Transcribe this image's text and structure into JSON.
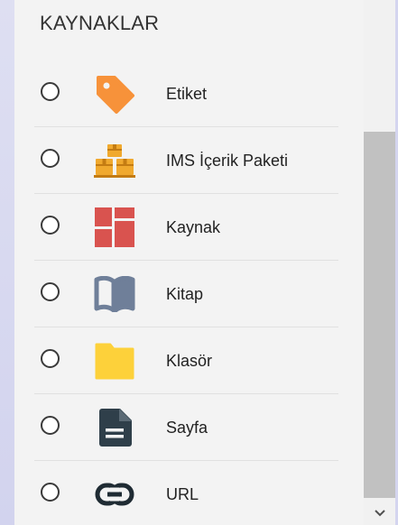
{
  "section": {
    "title": "KAYNAKLAR"
  },
  "items": [
    {
      "label": "Etiket",
      "icon": "label-tag-icon",
      "color": "#f7923a"
    },
    {
      "label": "IMS İçerik Paketi",
      "icon": "ims-package-icon",
      "color": "#f0a92e"
    },
    {
      "label": "Kaynak",
      "icon": "resource-grid-icon",
      "color": "#d9534f"
    },
    {
      "label": "Kitap",
      "icon": "book-icon",
      "color": "#6f7f99"
    },
    {
      "label": "Klasör",
      "icon": "folder-icon",
      "color": "#fdd13a"
    },
    {
      "label": "Sayfa",
      "icon": "page-document-icon",
      "color": "#2f3f4a"
    },
    {
      "label": "URL",
      "icon": "link-icon",
      "color": "#1f2b33"
    }
  ],
  "colors": {
    "background": "#d9daf1",
    "panel": "#f3f3f3",
    "scrollbar_track": "#f1f1f1",
    "scrollbar_thumb": "#c1c1c1"
  }
}
